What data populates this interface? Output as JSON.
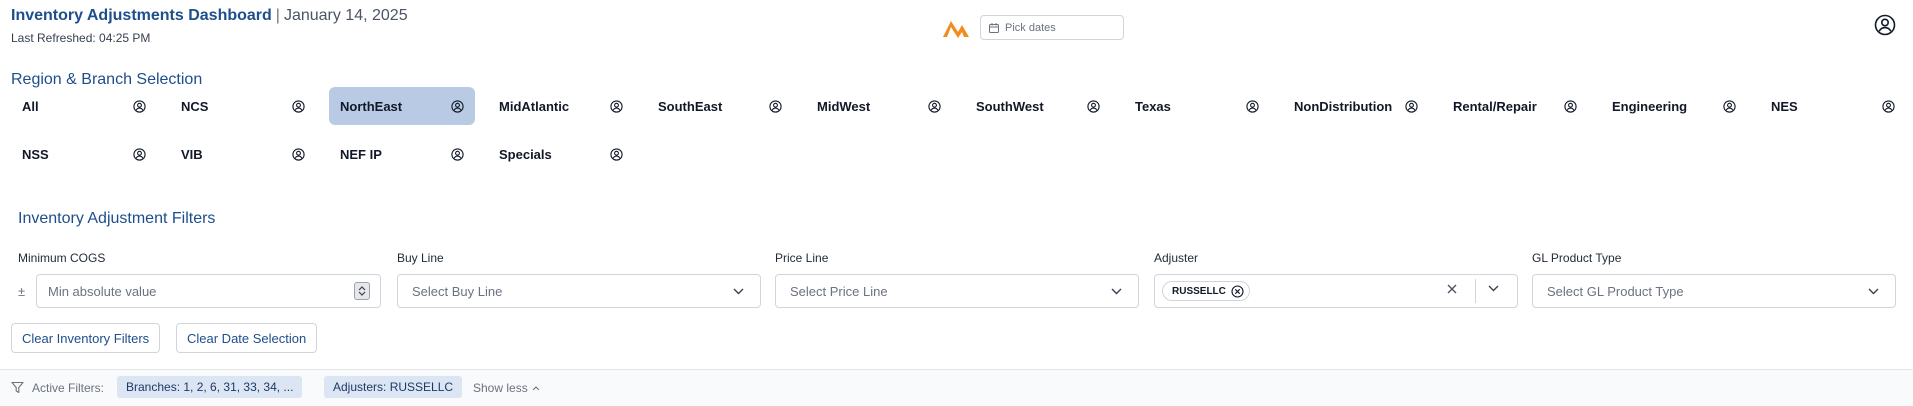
{
  "header": {
    "title": "Inventory Adjustments Dashboard",
    "separator": "|",
    "date": "January 14, 2025",
    "last_refreshed": "Last Refreshed: 04:25 PM",
    "date_picker_placeholder": "Pick dates"
  },
  "regions": {
    "title": "Region & Branch Selection",
    "row1": [
      "All",
      "NCS",
      "NorthEast",
      "MidAtlantic",
      "SouthEast",
      "MidWest",
      "SouthWest",
      "Texas",
      "NonDistribution",
      "Rental/Repair",
      "Engineering",
      "NES"
    ],
    "row2": [
      "NSS",
      "VIB",
      "NEF IP",
      "Specials"
    ],
    "selected": "NorthEast"
  },
  "filters": {
    "title": "Inventory Adjustment Filters",
    "min_cogs_label": "Minimum COGS",
    "min_cogs_prefix": "±",
    "min_cogs_placeholder": "Min absolute value",
    "buy_line_label": "Buy Line",
    "buy_line_placeholder": "Select Buy Line",
    "price_line_label": "Price Line",
    "price_line_placeholder": "Select Price Line",
    "adjuster_label": "Adjuster",
    "adjuster_selected": [
      "RUSSELLC"
    ],
    "gl_label": "GL Product Type",
    "gl_placeholder": "Select GL Product Type",
    "clear_inventory": "Clear Inventory Filters",
    "clear_date": "Clear Date Selection"
  },
  "active_filters": {
    "label": "Active Filters:",
    "chips": [
      "Branches: 1, 2, 6, 31, 33, 34, ...",
      "Adjusters: RUSSELLC"
    ],
    "toggle": "Show less"
  },
  "colors": {
    "accent": "#1e4e8c",
    "selected_bg": "#b9cbe4",
    "chip_bg": "#dbe5f3",
    "logo": "#f28c1e"
  }
}
